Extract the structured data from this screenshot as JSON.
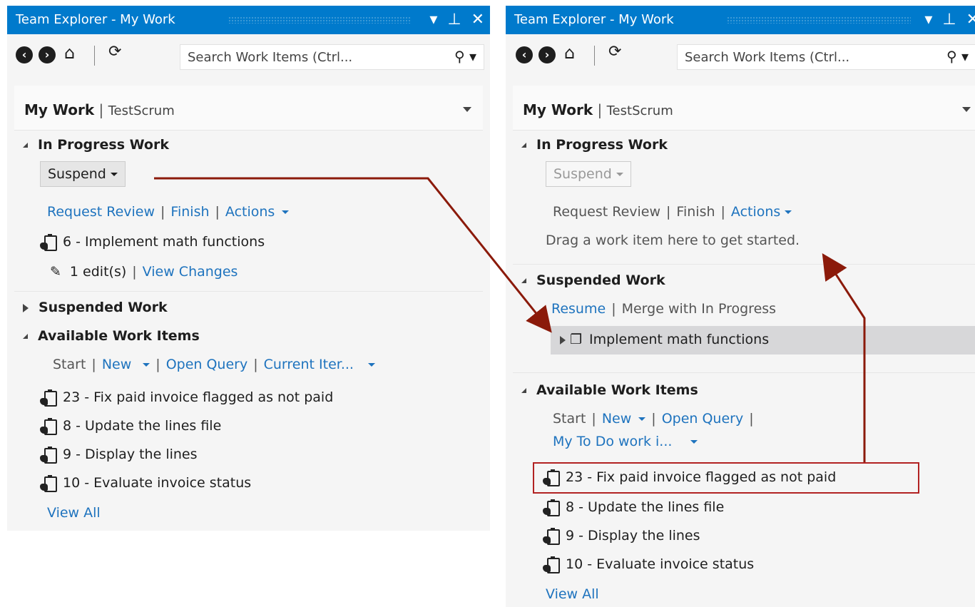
{
  "left": {
    "title": "Team Explorer - My Work",
    "search_placeholder": "Search Work Items (Ctrl...",
    "header_main": "My Work",
    "header_sep": "|",
    "header_project": "TestScrum",
    "in_progress": {
      "title": "In Progress Work",
      "suspend_label": "Suspend",
      "request_review": "Request Review",
      "finish": "Finish",
      "actions": "Actions",
      "item": "6 - Implement math functions",
      "edits": "1 edit(s)",
      "view_changes": "View Changes"
    },
    "suspended": {
      "title": "Suspended Work"
    },
    "available": {
      "title": "Available Work Items",
      "start": "Start",
      "new": "New",
      "open_query": "Open Query",
      "current_iter": "Current Iter...",
      "items": [
        "23 - Fix paid invoice flagged as not paid",
        "8 - Update the lines file",
        "9 - Display the lines",
        "10 - Evaluate invoice status"
      ],
      "view_all": "View All"
    }
  },
  "right": {
    "title": "Team Explorer - My Work",
    "search_placeholder": "Search Work Items (Ctrl...",
    "header_main": "My Work",
    "header_sep": "|",
    "header_project": "TestScrum",
    "in_progress": {
      "title": "In Progress Work",
      "suspend_label": "Suspend",
      "request_review": "Request Review",
      "finish": "Finish",
      "actions": "Actions",
      "empty_hint": "Drag a work item here to get started."
    },
    "suspended": {
      "title": "Suspended Work",
      "resume": "Resume",
      "merge": "Merge with In Progress",
      "item": "Implement math functions"
    },
    "available": {
      "title": "Available Work Items",
      "start": "Start",
      "new": "New",
      "open_query": "Open Query",
      "query_name": "My To Do work i...",
      "items": [
        "23 - Fix paid invoice flagged as not paid",
        "8 - Update the lines file",
        "9 - Display the lines",
        "10 - Evaluate invoice status"
      ],
      "view_all": "View All"
    }
  },
  "colors": {
    "titlebar": "#007acc",
    "link": "#1e73be",
    "annotation": "#8b1a0a",
    "highlight_box": "#b22222"
  }
}
